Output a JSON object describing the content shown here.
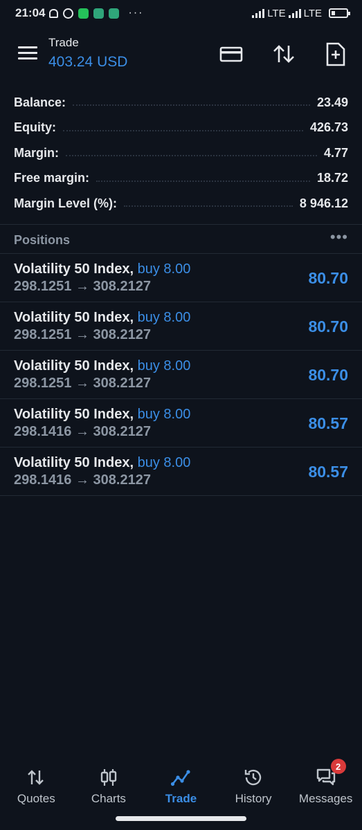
{
  "status_bar": {
    "time": "21:04",
    "notification_icons": [
      "bell-mute-icon",
      "alarm-icon",
      "whatsapp-icon",
      "chat-app-icon",
      "chat-app-icon"
    ],
    "more": "···",
    "network1": "LTE",
    "network2": "LTE",
    "battery_level": 0.25
  },
  "header": {
    "title": "Trade",
    "subtitle": "403.24 USD",
    "icons": [
      "menu-icon",
      "deposit-card-icon",
      "sort-icon",
      "new-order-icon"
    ]
  },
  "summary": {
    "rows": [
      {
        "label": "Balance:",
        "value": "23.49"
      },
      {
        "label": "Equity:",
        "value": "426.73"
      },
      {
        "label": "Margin:",
        "value": "4.77"
      },
      {
        "label": "Free margin:",
        "value": "18.72"
      },
      {
        "label": "Margin Level (%):",
        "value": "8 946.12"
      }
    ]
  },
  "positions": {
    "title": "Positions",
    "more": "•••",
    "items": [
      {
        "symbol": "Volatility 50 Index,",
        "side": "buy 8.00",
        "prices": "298.1251 → 308.2127",
        "profit": "80.70"
      },
      {
        "symbol": "Volatility 50 Index,",
        "side": "buy 8.00",
        "prices": "298.1251 → 308.2127",
        "profit": "80.70"
      },
      {
        "symbol": "Volatility 50 Index,",
        "side": "buy 8.00",
        "prices": "298.1251 → 308.2127",
        "profit": "80.70"
      },
      {
        "symbol": "Volatility 50 Index,",
        "side": "buy 8.00",
        "prices": "298.1416 → 308.2127",
        "profit": "80.57"
      },
      {
        "symbol": "Volatility 50 Index,",
        "side": "buy 8.00",
        "prices": "298.1416 → 308.2127",
        "profit": "80.57"
      }
    ]
  },
  "bottom_nav": {
    "items": [
      {
        "label": "Quotes",
        "icon": "quotes-arrows-icon"
      },
      {
        "label": "Charts",
        "icon": "candlestick-icon"
      },
      {
        "label": "Trade",
        "icon": "trade-line-icon",
        "active": true
      },
      {
        "label": "History",
        "icon": "history-clock-icon"
      },
      {
        "label": "Messages",
        "icon": "messages-icon",
        "badge": "2"
      }
    ]
  },
  "colors": {
    "background": "#0e131c",
    "accent": "#3b8ee6",
    "text": "#e6e8eb",
    "muted": "#8c96a3",
    "badge": "#d93a3a"
  }
}
